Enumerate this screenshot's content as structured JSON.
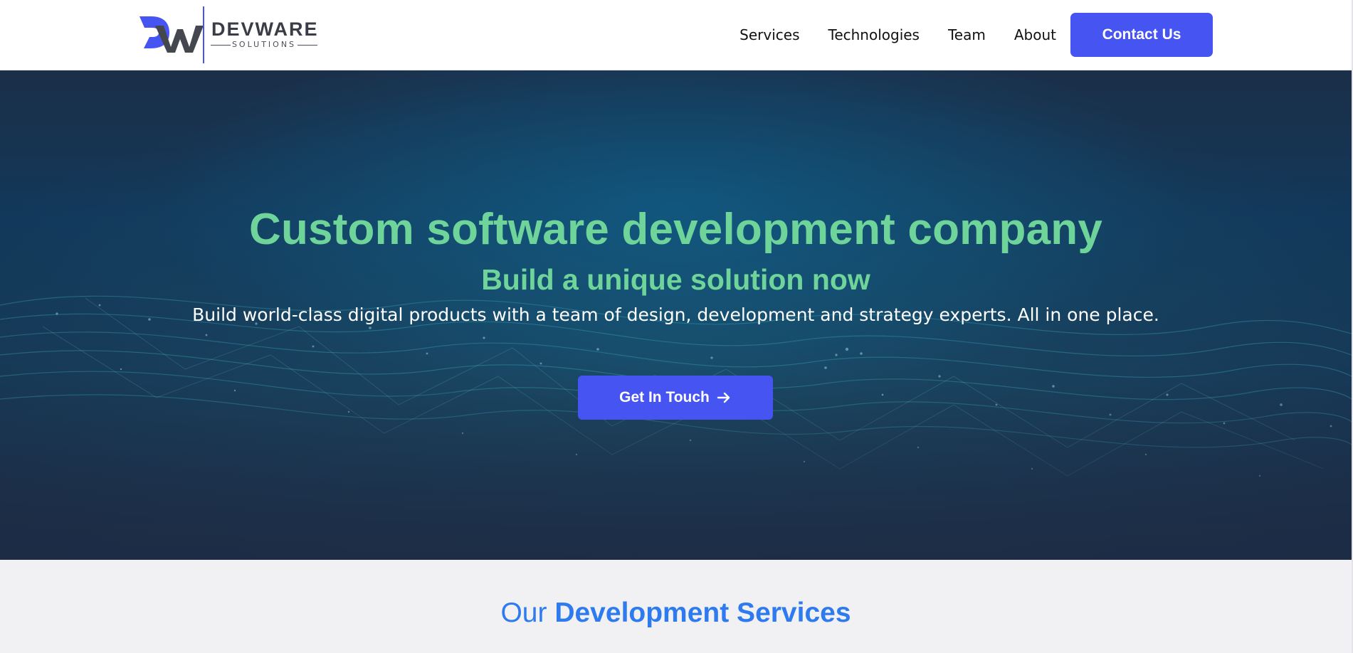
{
  "brand": {
    "logo_mark": "DW",
    "name": "DEVWARE",
    "tagline": "SOLUTIONS",
    "colors": {
      "mark_blue": "#4654f2",
      "mark_gray": "#45474f",
      "divider": "#4654f2"
    }
  },
  "nav": {
    "items": [
      "Services",
      "Technologies",
      "Team",
      "About"
    ],
    "contact_label": "Contact Us"
  },
  "hero": {
    "title": "Custom software development company",
    "subtitle": "Build a unique solution now",
    "text": "Build world-class digital products with a team of design, development and strategy experts. All in one place.",
    "cta_label": "Get In Touch",
    "cta_icon": "arrow-right-icon"
  },
  "services": {
    "heading_light": "Our",
    "heading_bold": "Development Services"
  },
  "colors": {
    "accent": "#4654f2",
    "hero_heading": "#6fd49a",
    "services_heading": "#2d7bef",
    "hero_bg": "#163654"
  }
}
